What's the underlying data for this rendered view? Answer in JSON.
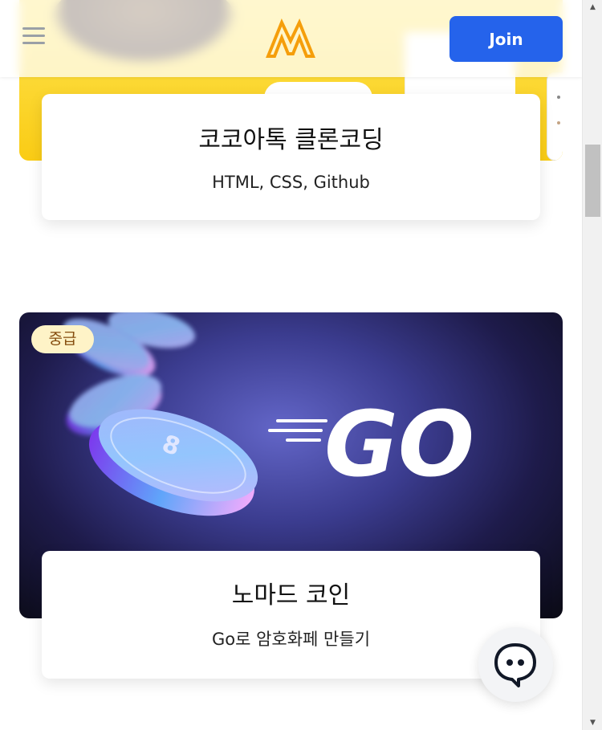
{
  "header": {
    "menu_icon": "hamburger-menu-icon",
    "logo_icon": "nomad-coders-logo",
    "join_label": "Join",
    "brand_color": "#2563eb",
    "logo_color": "#f59e0b"
  },
  "courses": [
    {
      "title": "코코아톡 클론코딩",
      "subtitle": "HTML, CSS, Github",
      "badge": ""
    },
    {
      "title": "노마드 코인",
      "subtitle": "Go로 암호화페 만들기",
      "badge": "중급",
      "image_text": "GO"
    }
  ],
  "chat": {
    "icon": "chat-bubble-icon"
  },
  "scrollbar": {
    "up_icon": "arrow-up-icon",
    "down_icon": "arrow-down-icon"
  }
}
